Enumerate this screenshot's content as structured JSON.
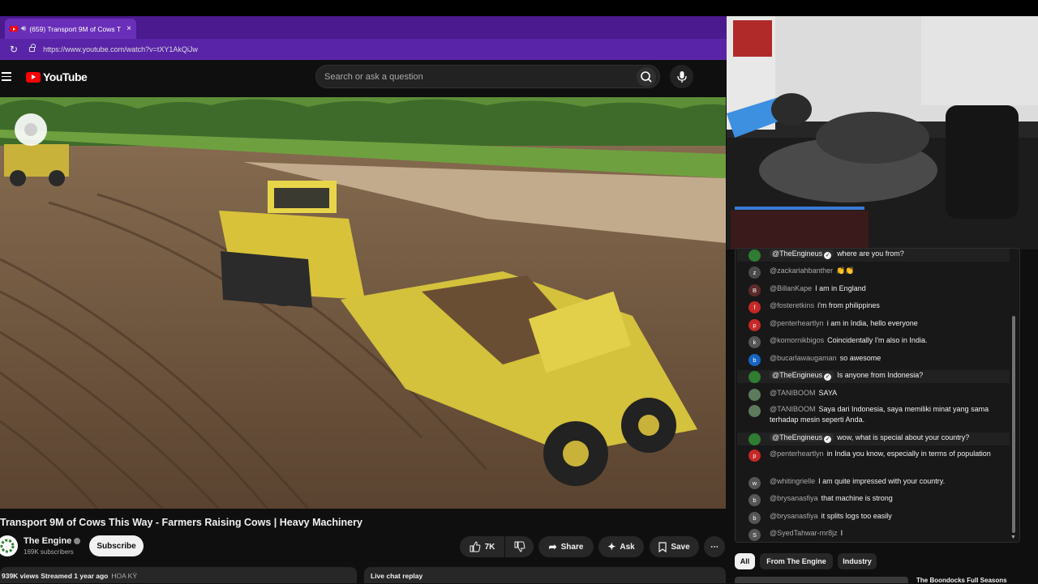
{
  "browser": {
    "tab_title": "(659) Transport 9M of Cows T",
    "tab_close": "×",
    "new_tab": "+",
    "url": "https://www.youtube.com/watch?v=tXY1AkQiJw"
  },
  "youtube": {
    "logo_text": "YouTube",
    "search_placeholder": "Search or ask a question"
  },
  "video": {
    "title": "Transport 9M of Cows This Way - Farmers Raising Cows | Heavy Machinery",
    "channel_name": "The Engine",
    "subscribers": "169K subscribers",
    "subscribe_label": "Subscribe",
    "likes": "7K",
    "share_label": "Share",
    "ask_label": "Ask",
    "save_label": "Save",
    "more_label": "⋯",
    "meta": "939K views  Streamed 1 year ago",
    "region": "HOA KỲ",
    "live_chat_replay": "Live chat replay"
  },
  "chat": {
    "messages": [
      {
        "initial": "",
        "color": "#2e7d32",
        "author": "@TheEngineus",
        "owner": true,
        "text": "where are you from?"
      },
      {
        "initial": "z",
        "color": "#4a4a4a",
        "author": "@zackariahbanther",
        "owner": false,
        "text": "👏👏"
      },
      {
        "initial": "B",
        "color": "#5c2a2a",
        "author": "@BillanKape",
        "owner": false,
        "text": "I am in England"
      },
      {
        "initial": "f",
        "color": "#c62828",
        "author": "@fosteretkins",
        "owner": false,
        "text": "i'm from philippines"
      },
      {
        "initial": "p",
        "color": "#c62828",
        "author": "@penterheartlyn",
        "owner": false,
        "text": "i am in India, hello everyone"
      },
      {
        "initial": "k",
        "color": "#555555",
        "author": "@komornikbigos",
        "owner": false,
        "text": "Coincidentally I'm also in India."
      },
      {
        "initial": "b",
        "color": "#1565c0",
        "author": "@bucarlawaugaman",
        "owner": false,
        "text": "so awesome"
      },
      {
        "initial": "",
        "color": "#2e7d32",
        "author": "@TheEngineus",
        "owner": true,
        "text": "Is anyone from Indonesia?"
      },
      {
        "initial": "",
        "color": "#5d7a5d",
        "author": "@TANIBOOM",
        "owner": false,
        "text": "SAYA"
      },
      {
        "initial": "",
        "color": "#5d7a5d",
        "author": "@TANIBOOM",
        "owner": false,
        "text": "Saya dari Indonesia, saya memiliki minat yang sama terhadap mesin seperti Anda."
      },
      {
        "initial": "",
        "color": "#2e7d32",
        "author": "@TheEngineus",
        "owner": true,
        "text": "wow, what is special about your country?"
      },
      {
        "initial": "p",
        "color": "#c62828",
        "author": "@penterheartlyn",
        "owner": false,
        "text": "in India you know, especially in terms of population"
      },
      {
        "initial": "w",
        "color": "#555555",
        "author": "@whitingrielle",
        "owner": false,
        "text": "I am quite impressed with your country."
      },
      {
        "initial": "b",
        "color": "#555555",
        "author": "@brysanasfiya",
        "owner": false,
        "text": "that machine is strong"
      },
      {
        "initial": "b",
        "color": "#555555",
        "author": "@brysanasfiya",
        "owner": false,
        "text": "it splits logs too easily"
      },
      {
        "initial": "S",
        "color": "#555555",
        "author": "@SyedTahwar-mr8jz",
        "owner": false,
        "text": "I"
      }
    ],
    "filters": [
      "All",
      "From The Engine",
      "Industry"
    ],
    "next_video_title": "The Boondocks Full Seasons"
  }
}
